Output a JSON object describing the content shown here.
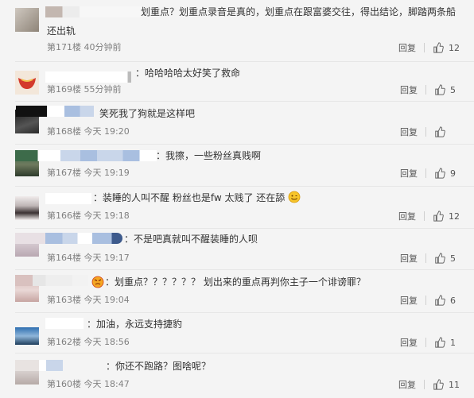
{
  "comments": [
    {
      "text": "划重点？划重点录音是真的，划重点在跟富婆交往，得出结论，脚踏两条船还出轨",
      "floor": "第171楼",
      "time": "40分钟前",
      "reply": "回复",
      "likes": "12"
    },
    {
      "text": "：哈哈哈哈太好笑了救命",
      "floor": "第169楼",
      "time": "55分钟前",
      "reply": "回复",
      "likes": "5"
    },
    {
      "text": "笑死我了狗就是这样吧",
      "floor": "第168楼",
      "time": "今天 19:20",
      "reply": "回复",
      "likes": ""
    },
    {
      "text": "：我擦，一些粉丝真贱啊",
      "floor": "第167楼",
      "time": "今天 19:19",
      "reply": "回复",
      "likes": "9"
    },
    {
      "text": "：装睡的人叫不醒 粉丝也是fw 太贱了 还在舔",
      "floor": "第166楼",
      "time": "今天 19:18",
      "reply": "回复",
      "likes": "12"
    },
    {
      "text": "：不是吧真就叫不醒装睡的人呗",
      "floor": "第164楼",
      "time": "今天 19:17",
      "reply": "回复",
      "likes": "5"
    },
    {
      "text": "：划重点？？？？？？ 划出来的重点再判你主子一个诽谤罪？",
      "floor": "第163楼",
      "time": "今天 19:04",
      "reply": "回复",
      "likes": "6"
    },
    {
      "text": "：加油，永远支持捷豹",
      "floor": "第162楼",
      "time": "今天 18:56",
      "reply": "回复",
      "likes": "1"
    },
    {
      "text": "：你还不跑路？图啥呢？",
      "floor": "第160楼",
      "time": "今天 18:47",
      "reply": "回复",
      "likes": "11"
    }
  ],
  "icons": {
    "like": "thumbs-up-icon",
    "emoji": "smile-emoji-icon"
  },
  "colors": {
    "background": "#f4f4f4",
    "text": "#333333",
    "meta": "#808080",
    "divider": "#e6e6e6",
    "name_mask": "#a9bfe0"
  }
}
